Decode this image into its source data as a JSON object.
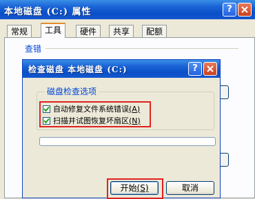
{
  "outer": {
    "title": "本地磁盘 (C:) 属性",
    "help_label": "?",
    "tabs": [
      {
        "label": "常规"
      },
      {
        "label": "工具"
      },
      {
        "label": "硬件"
      },
      {
        "label": "共享"
      },
      {
        "label": "配额"
      }
    ],
    "active_tab": "工具",
    "group_error_check": "查错"
  },
  "dialog": {
    "title": "检查磁盘 本地磁盘 (C:)",
    "help_label": "?",
    "options_legend": "磁盘检查选项",
    "options": [
      {
        "label": "自动修复文件系统错误 ",
        "accel": "(A)",
        "checked": true
      },
      {
        "label": "扫描并试图恢复坏扇区 ",
        "accel": "(N)",
        "checked": true
      }
    ],
    "progress": 0,
    "start_label": "开始",
    "start_accel": "(S)",
    "cancel_label": "取消"
  },
  "colors": {
    "titlebar": "#0a4fc7",
    "highlight": "#e02020",
    "tab_accent": "#e68b2c"
  }
}
